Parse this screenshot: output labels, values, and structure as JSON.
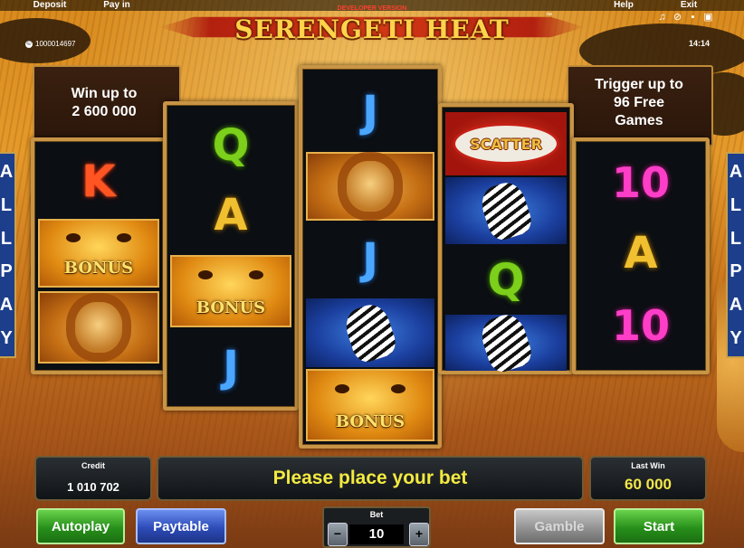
{
  "top_menu": {
    "deposit": "Deposit",
    "pay_in": "Pay in",
    "help": "Help",
    "exit": "Exit"
  },
  "account_id": "1000014697",
  "clock": "14:14",
  "logo": {
    "title": "SERENGETI HEAT",
    "developer_label": "DEVELOPER VERSION",
    "trademark": "™"
  },
  "info": {
    "win_up_to_line1": "Win up to",
    "win_up_to_amount": "2 600 000",
    "trigger_line1": "Trigger up to",
    "trigger_line2": "96 Free",
    "trigger_line3": "Games"
  },
  "all_pay": [
    "A",
    "L",
    "L",
    "P",
    "A",
    "Y"
  ],
  "reels": [
    {
      "symbols": [
        {
          "type": "K",
          "text": "K"
        },
        {
          "type": "bonus",
          "text": "BONUS"
        },
        {
          "type": "lion"
        }
      ]
    },
    {
      "symbols": [
        {
          "type": "Q",
          "text": "Q"
        },
        {
          "type": "A",
          "text": "A"
        },
        {
          "type": "bonus",
          "text": "BONUS"
        },
        {
          "type": "J",
          "text": "J"
        }
      ]
    },
    {
      "symbols": [
        {
          "type": "J",
          "text": "J"
        },
        {
          "type": "lion"
        },
        {
          "type": "J",
          "text": "J"
        },
        {
          "type": "zebra"
        },
        {
          "type": "bonus",
          "text": "BONUS"
        }
      ]
    },
    {
      "symbols": [
        {
          "type": "scatter",
          "text": "SCATTER"
        },
        {
          "type": "zebra"
        },
        {
          "type": "Q",
          "text": "Q"
        },
        {
          "type": "zebra"
        }
      ]
    },
    {
      "symbols": [
        {
          "type": "10",
          "text": "10"
        },
        {
          "type": "A",
          "text": "A"
        },
        {
          "type": "10",
          "text": "10"
        }
      ]
    }
  ],
  "status": {
    "credit_label": "Credit",
    "credit_value": "1 010 702",
    "message": "Please place your bet",
    "last_win_label": "Last Win",
    "last_win_value": "60 000"
  },
  "controls": {
    "autoplay": "Autoplay",
    "paytable": "Paytable",
    "bet_label": "Bet",
    "bet_value": "10",
    "minus": "−",
    "plus": "+",
    "gamble": "Gamble",
    "start": "Start"
  },
  "colors": {
    "message_yellow": "#f3ea40",
    "frame_gold": "#c89445",
    "all_pay_blue": "#1d3e8a"
  }
}
